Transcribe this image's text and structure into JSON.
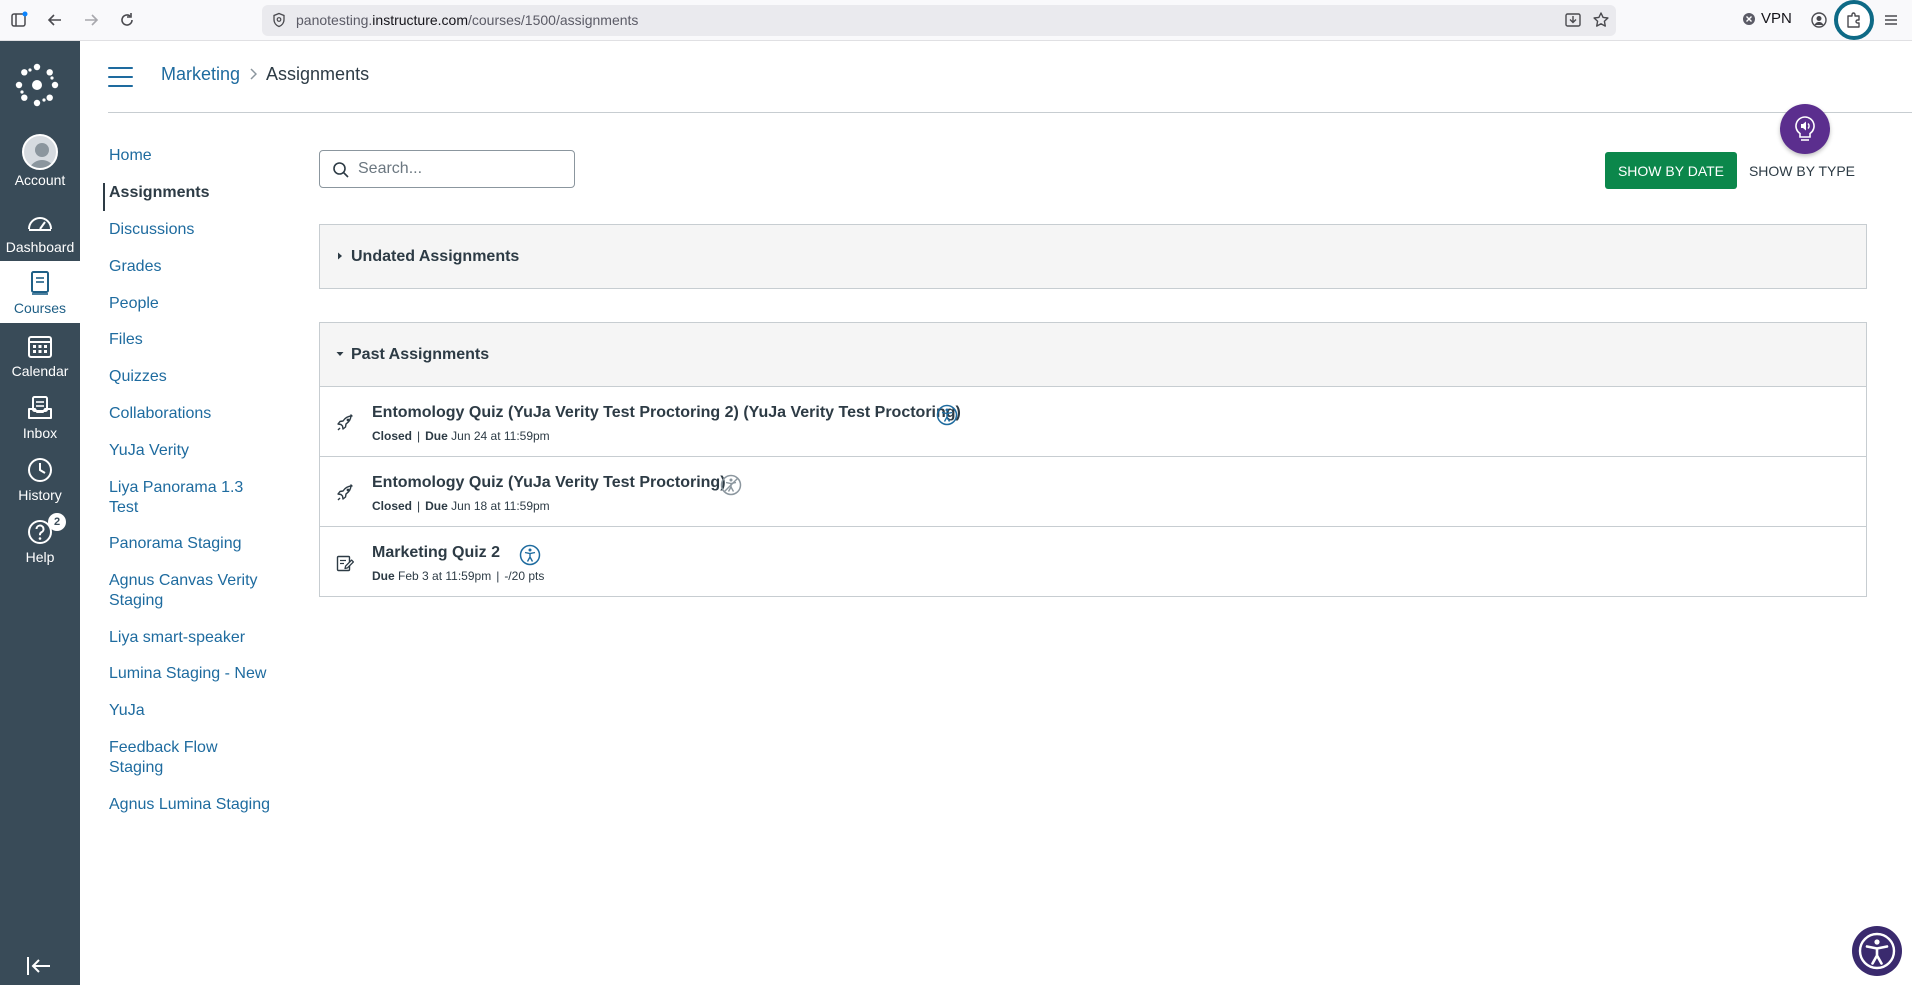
{
  "browser": {
    "url_prefix": "panotesting.",
    "url_host": "instructure.com",
    "url_path": "/courses/1500/assignments",
    "vpn_label": "VPN"
  },
  "global_nav": {
    "items": [
      {
        "label": "Account"
      },
      {
        "label": "Dashboard"
      },
      {
        "label": "Courses"
      },
      {
        "label": "Calendar"
      },
      {
        "label": "Inbox"
      },
      {
        "label": "History"
      },
      {
        "label": "Help",
        "badge": "2"
      }
    ]
  },
  "header": {
    "breadcrumb_course": "Marketing",
    "breadcrumb_page": "Assignments"
  },
  "course_nav": {
    "items": [
      {
        "label": "Home"
      },
      {
        "label": "Assignments"
      },
      {
        "label": "Discussions"
      },
      {
        "label": "Grades"
      },
      {
        "label": "People"
      },
      {
        "label": "Files"
      },
      {
        "label": "Quizzes"
      },
      {
        "label": "Collaborations"
      },
      {
        "label": "YuJa Verity"
      },
      {
        "label": "Liya Panorama 1.3 Test"
      },
      {
        "label": "Panorama Staging"
      },
      {
        "label": "Agnus Canvas Verity Staging"
      },
      {
        "label": "Liya smart-speaker"
      },
      {
        "label": "Lumina Staging - New"
      },
      {
        "label": "YuJa"
      },
      {
        "label": "Feedback Flow Staging"
      },
      {
        "label": "Agnus Lumina Staging"
      }
    ]
  },
  "toolbar": {
    "search_placeholder": "Search...",
    "show_by_date": "SHOW BY DATE",
    "show_by_type": "SHOW BY TYPE"
  },
  "groups": {
    "undated": {
      "title": "Undated Assignments"
    },
    "past": {
      "title": "Past Assignments",
      "assignments": [
        {
          "title": "Entomology Quiz (YuJa Verity Test Proctoring 2) (YuJa Verity Test Proctoring)",
          "status": "Closed",
          "due_label": "Due",
          "due": "Jun 24 at 11:59pm",
          "icon": "quiz-rocket-icon",
          "accessibility_icon_color": "#1e6b9f"
        },
        {
          "title": "Entomology Quiz (YuJa Verity Test Proctoring)",
          "status": "Closed",
          "due_label": "Due",
          "due": "Jun 18 at 11:59pm",
          "icon": "quiz-rocket-icon",
          "accessibility_icon_color": "#8b969e"
        },
        {
          "title": "Marketing Quiz 2",
          "due_label": "Due",
          "due": "Feb 3 at 11:59pm",
          "points": "-/20 pts",
          "icon": "quiz-edit-icon",
          "accessibility_icon_color": "#1e6b9f"
        }
      ]
    }
  },
  "colors": {
    "nav_bg": "#394b58",
    "link": "#1e6b9f",
    "primary_button": "#0b874b"
  }
}
